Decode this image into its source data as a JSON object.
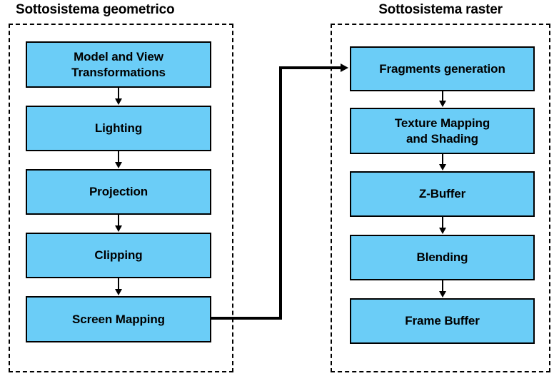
{
  "diagram": {
    "subsystems": [
      {
        "id": "geometric",
        "title": "Sottosistema geometrico",
        "stages": [
          {
            "label": "Model and View Transformations",
            "line1": "Model and View",
            "line2": "Transformations"
          },
          {
            "label": "Lighting",
            "line1": "Lighting",
            "line2": ""
          },
          {
            "label": "Projection",
            "line1": "Projection",
            "line2": ""
          },
          {
            "label": "Clipping",
            "line1": "Clipping",
            "line2": ""
          },
          {
            "label": "Screen Mapping",
            "line1": "Screen Mapping",
            "line2": ""
          }
        ]
      },
      {
        "id": "raster",
        "title": "Sottosistema raster",
        "stages": [
          {
            "label": "Fragments generation",
            "line1": "Fragments generation",
            "line2": ""
          },
          {
            "label": "Texture Mapping and Shading",
            "line1": "Texture Mapping",
            "line2": "and Shading"
          },
          {
            "label": "Z-Buffer",
            "line1": "Z-Buffer",
            "line2": ""
          },
          {
            "label": "Blending",
            "line1": "Blending",
            "line2": ""
          },
          {
            "label": "Frame Buffer",
            "line1": "Frame Buffer",
            "line2": ""
          }
        ]
      }
    ],
    "colors": {
      "stage_fill": "#6bcdf7",
      "stage_border": "#000000",
      "container_border": "#000000",
      "text": "#000000",
      "background": "#ffffff"
    }
  }
}
